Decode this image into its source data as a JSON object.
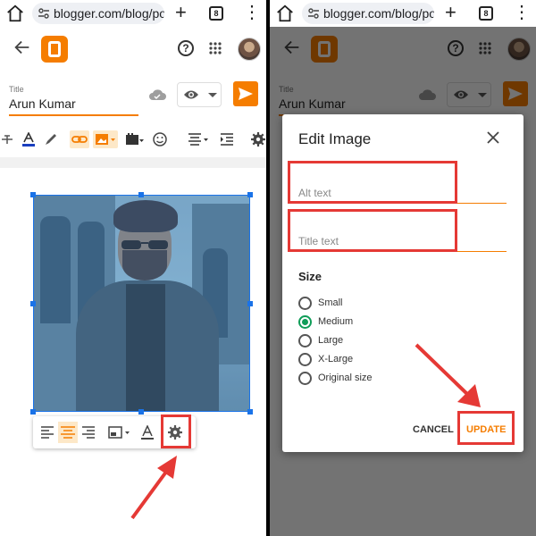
{
  "browser": {
    "url": "blogger.com/blog/pos",
    "tab_count": "8"
  },
  "editor": {
    "title_label": "Title",
    "title_value": "Arun Kumar"
  },
  "dialog": {
    "title": "Edit Image",
    "alt_placeholder": "Alt text",
    "title_placeholder": "Title text",
    "size_label": "Size",
    "sizes": [
      "Small",
      "Medium",
      "Large",
      "X-Large",
      "Original size"
    ],
    "selected_size": "Medium",
    "cancel_label": "CANCEL",
    "update_label": "UPDATE"
  },
  "colors": {
    "brand": "#f57d00",
    "annotation": "#e53935",
    "radio_selected": "#0f9d58"
  }
}
